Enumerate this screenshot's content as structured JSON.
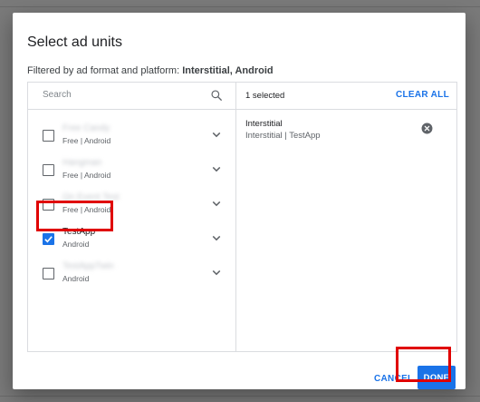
{
  "dialog": {
    "title": "Select ad units",
    "filter_prefix": "Filtered by ad format and platform: ",
    "filter_value": "Interstitial, Android"
  },
  "search": {
    "placeholder": "Search",
    "icon": "search-icon"
  },
  "ad_units": [
    {
      "name": "Free Candy",
      "subtitle": "Free | Android",
      "checked": false,
      "blurred": true
    },
    {
      "name": "Hangman",
      "subtitle": "Free | Android",
      "checked": false,
      "blurred": true
    },
    {
      "name": "Qn Event Test",
      "subtitle": "Free | Android",
      "checked": false,
      "blurred": true
    },
    {
      "name": "TestApp",
      "subtitle": "Android",
      "checked": true,
      "blurred": false
    },
    {
      "name": "TestAppTwin",
      "subtitle": "Android",
      "checked": false,
      "blurred": true
    }
  ],
  "selection": {
    "count_text": "1 selected",
    "clear_label": "CLEAR ALL",
    "items": [
      {
        "name": "Interstitial",
        "detail": "Interstitial | TestApp"
      }
    ]
  },
  "actions": {
    "cancel_label": "CANCEL",
    "done_label": "DONE"
  },
  "colors": {
    "accent": "#1a73e8",
    "highlight": "#e00000"
  }
}
